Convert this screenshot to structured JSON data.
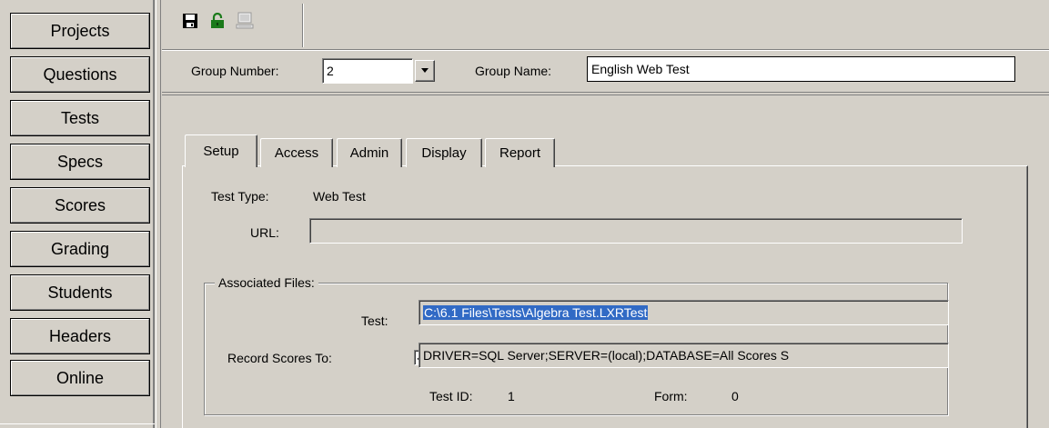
{
  "nav": {
    "items": [
      {
        "label": "Projects"
      },
      {
        "label": "Questions"
      },
      {
        "label": "Tests"
      },
      {
        "label": "Specs"
      },
      {
        "label": "Scores"
      },
      {
        "label": "Grading"
      },
      {
        "label": "Students"
      },
      {
        "label": "Headers"
      },
      {
        "label": "Online"
      }
    ]
  },
  "toolbar": {
    "icons": [
      "save-icon",
      "unlock-icon",
      "computer-icon"
    ]
  },
  "group": {
    "number_label": "Group Number:",
    "number_value": "2",
    "name_label": "Group Name:",
    "name_value": "English Web Test"
  },
  "tabs": [
    {
      "label": "Setup"
    },
    {
      "label": "Access"
    },
    {
      "label": "Admin"
    },
    {
      "label": "Display"
    },
    {
      "label": "Report"
    }
  ],
  "setup": {
    "test_type_label": "Test Type:",
    "test_type_value": "Web Test",
    "url_label": "URL:",
    "url_value": "",
    "associated_files_title": "Associated Files:",
    "test_label": "Test:",
    "test_value": "C:\\6.1 Files\\Tests\\Algebra Test.LXRTest",
    "record_scores_label": "Record Scores To:",
    "record_scores_checked": true,
    "record_scores_value": "DRIVER=SQL Server;SERVER=(local);DATABASE=All Scores S",
    "test_id_label": "Test ID:",
    "test_id_value": "1",
    "form_label": "Form:",
    "form_value": "0"
  },
  "colors": {
    "face": "#d4d0c8",
    "selection": "#316ac5",
    "save_icon": "#000000",
    "unlock_icon": "#1a7a1a"
  }
}
